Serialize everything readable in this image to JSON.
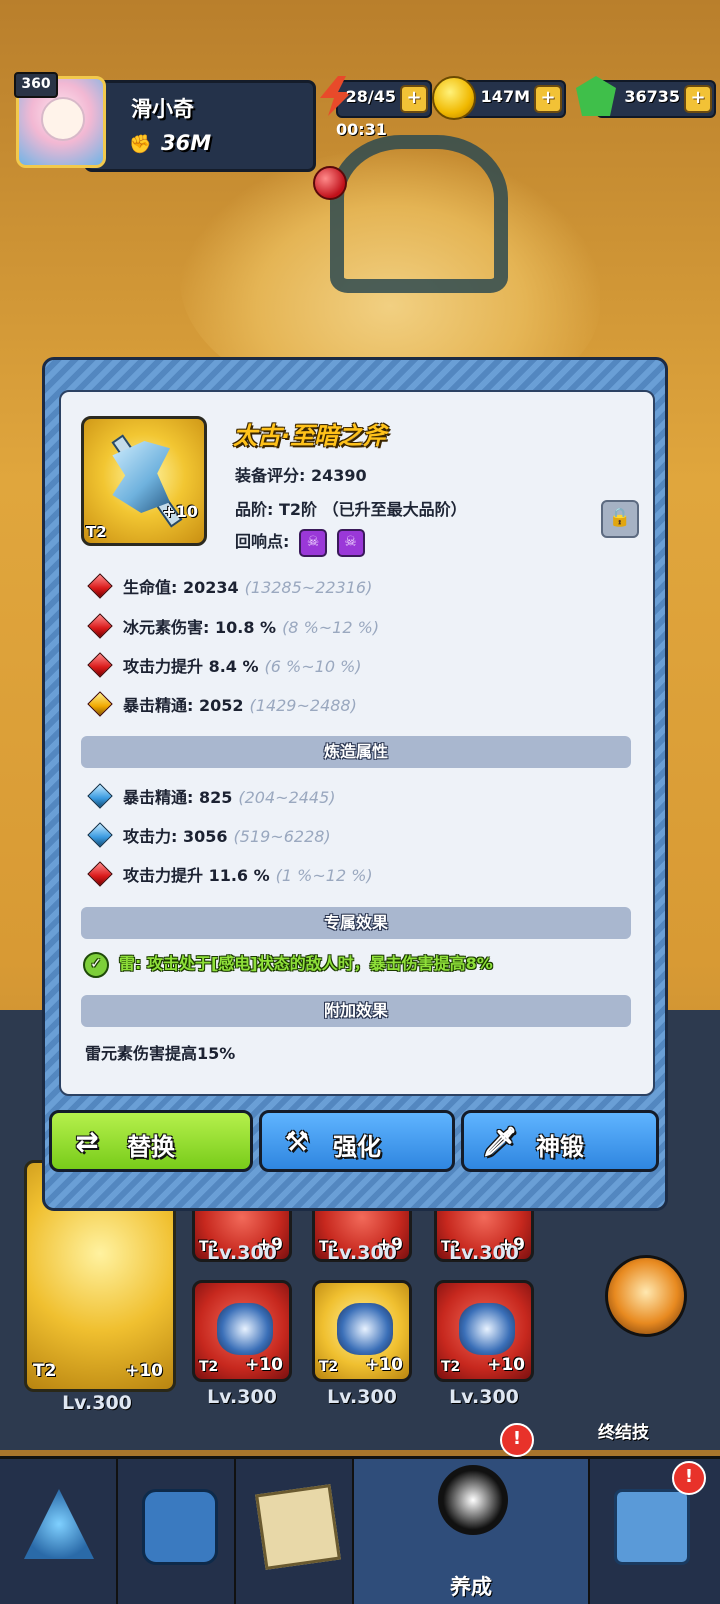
{
  "player": {
    "level": "360",
    "name": "滑小奇",
    "power": "36M"
  },
  "resources": {
    "energy": "28/45",
    "energy_timer": "00:31",
    "coins": "147M",
    "gems": "36735",
    "add_label": "+"
  },
  "item": {
    "name": "太古·至暗之斧",
    "score_line": "装备评分: 24390",
    "grade_line": "品阶: T2阶 （已升至最大品阶）",
    "echo_label": "回响点:",
    "tier": "T2",
    "enhance": "+10"
  },
  "base_stats": [
    {
      "label": "生命值: 20234",
      "range": "(13285~22316)",
      "gem": "red"
    },
    {
      "label": "冰元素伤害: 10.8 %",
      "range": "(8 %~12 %)",
      "gem": "red"
    },
    {
      "label": "攻击力提升 8.4 %",
      "range": "(6 %~10 %)",
      "gem": "red"
    },
    {
      "label": "暴击精通: 2052",
      "range": "(1429~2488)",
      "gem": "gold"
    }
  ],
  "forge_section": {
    "title": "炼造属性"
  },
  "forge_stats": [
    {
      "label": "暴击精通: 825",
      "range": "(204~2445)",
      "gem": "blue"
    },
    {
      "label": "攻击力: 3056",
      "range": "(519~6228)",
      "gem": "blue"
    },
    {
      "label": "攻击力提升 11.6 %",
      "range": "(1 %~12 %)",
      "gem": "red"
    }
  ],
  "exclusive_section": {
    "title": "专属效果",
    "text": "雷: 攻击处于[感电]状态的敌人时，暴击伤害提高8%"
  },
  "extra_section": {
    "title": "附加效果",
    "text": "雷元素伤害提高15%"
  },
  "buttons": {
    "replace": "替换",
    "enhance": "强化",
    "divine_forge": "神锻"
  },
  "equipment": {
    "main": {
      "tier": "T2",
      "enhance": "+10",
      "level": "Lv.300"
    },
    "top_row": [
      {
        "tier": "T2",
        "enhance": "+9",
        "level": "Lv.300"
      },
      {
        "tier": "T2",
        "enhance": "+9",
        "level": "Lv.300"
      },
      {
        "tier": "T2",
        "enhance": "+9",
        "level": "Lv.300"
      }
    ],
    "bottom_row": [
      {
        "tier": "T2",
        "enhance": "+10",
        "level": "Lv.300",
        "color": "red"
      },
      {
        "tier": "T2",
        "enhance": "+10",
        "level": "Lv.300",
        "color": "gold"
      },
      {
        "tier": "T2",
        "enhance": "+10",
        "level": "Lv.300",
        "color": "red"
      }
    ],
    "ultimate_label": "终结技"
  },
  "nav": {
    "active_label": "养成",
    "alert": "!"
  },
  "colors": {
    "item_name": "#ffc21a",
    "exclusive_text": "#8fe03a",
    "replace_btn": "#9ee03a",
    "blue_btn": "#3f96ea"
  }
}
